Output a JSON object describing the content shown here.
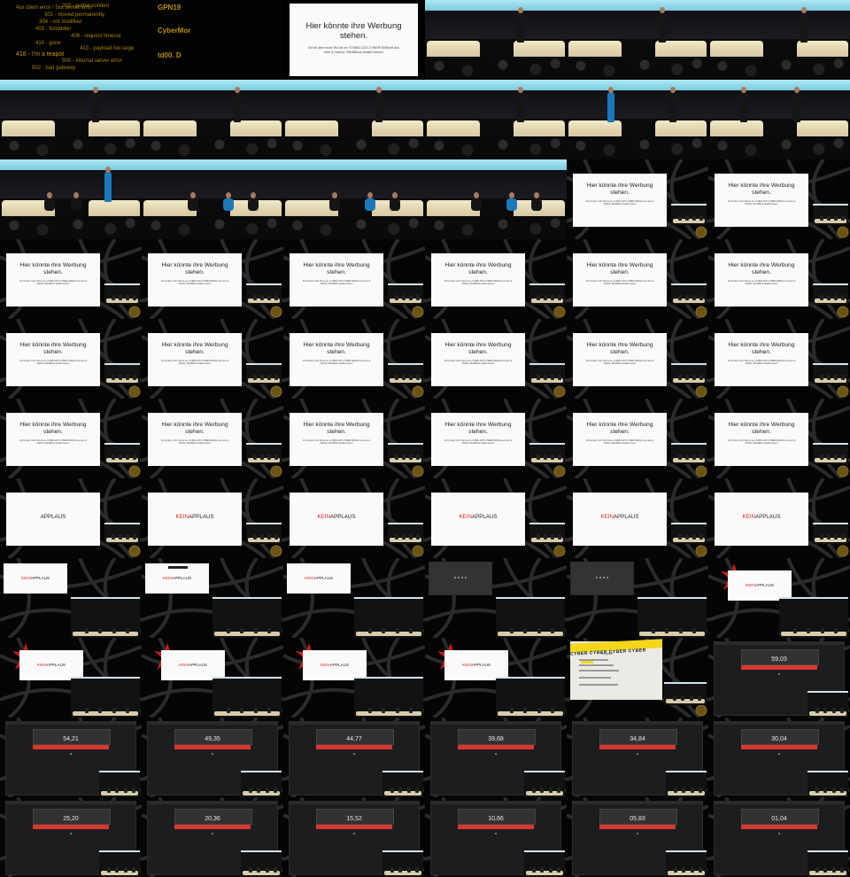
{
  "rows": [
    [
      {
        "kind": "term",
        "lines": [
          "4xx client error / 5xx server error",
          "202 - partial content",
          "301 - moved permanently",
          "304 - not modified",
          "403 - forbidden",
          "408 - request timeout",
          "410 - gone",
          "413 - payload too large",
          "418 - I'm a teapot",
          "500 - internal server error",
          "502 - bad gateway"
        ]
      },
      {
        "kind": "term2",
        "words": [
          "GPN19",
          "CyberMor",
          "td00. D"
        ]
      },
      {
        "kind": "ad-full"
      },
      {
        "kind": "stage",
        "variant": "single"
      },
      {
        "kind": "stage",
        "variant": "single"
      },
      {
        "kind": "stage",
        "variant": "single"
      }
    ],
    [
      {
        "kind": "stage",
        "variant": "single"
      },
      {
        "kind": "stage",
        "variant": "single"
      },
      {
        "kind": "stage",
        "variant": "single"
      },
      {
        "kind": "stage",
        "variant": "single"
      },
      {
        "kind": "stage",
        "variant": "blue-walk"
      },
      {
        "kind": "stage",
        "variant": "pair"
      }
    ],
    [
      {
        "kind": "stage",
        "variant": "seated-blue"
      },
      {
        "kind": "stage",
        "variant": "seated"
      },
      {
        "kind": "stage",
        "variant": "seated"
      },
      {
        "kind": "stage",
        "variant": "seated"
      },
      {
        "kind": "web-ad"
      },
      {
        "kind": "web-ad"
      }
    ],
    [
      {
        "kind": "web-ad"
      },
      {
        "kind": "web-ad"
      },
      {
        "kind": "web-ad"
      },
      {
        "kind": "web-ad"
      },
      {
        "kind": "web-ad"
      },
      {
        "kind": "web-ad"
      }
    ],
    [
      {
        "kind": "web-ad"
      },
      {
        "kind": "web-ad"
      },
      {
        "kind": "web-ad"
      },
      {
        "kind": "web-ad"
      },
      {
        "kind": "web-ad"
      },
      {
        "kind": "web-ad"
      }
    ],
    [
      {
        "kind": "web-ad"
      },
      {
        "kind": "web-ad"
      },
      {
        "kind": "web-ad"
      },
      {
        "kind": "web-ad"
      },
      {
        "kind": "web-ad"
      },
      {
        "kind": "web-ad"
      }
    ],
    [
      {
        "kind": "applaus",
        "kein": false
      },
      {
        "kind": "applaus",
        "kein": true
      },
      {
        "kind": "applaus",
        "kein": true
      },
      {
        "kind": "applaus",
        "kein": true
      },
      {
        "kind": "applaus",
        "kein": true
      },
      {
        "kind": "applaus",
        "kein": true
      }
    ],
    [
      {
        "kind": "applaus-small",
        "kein": true,
        "bar": false
      },
      {
        "kind": "applaus-small",
        "kein": true,
        "bar": true
      },
      {
        "kind": "applaus-small",
        "kein": true,
        "bar": false
      },
      {
        "kind": "dark-window"
      },
      {
        "kind": "dark-window"
      },
      {
        "kind": "applaus-red",
        "kein": true
      }
    ],
    [
      {
        "kind": "applaus-red",
        "kein": true
      },
      {
        "kind": "applaus-red",
        "kein": true
      },
      {
        "kind": "applaus-red",
        "kein": true
      },
      {
        "kind": "applaus-red",
        "kein": true
      },
      {
        "kind": "cyber"
      },
      {
        "kind": "timer",
        "time": "59,03"
      }
    ],
    [
      {
        "kind": "timer",
        "time": "54,21"
      },
      {
        "kind": "timer",
        "time": "49,35"
      },
      {
        "kind": "timer",
        "time": "44,77"
      },
      {
        "kind": "timer",
        "time": "39,68"
      },
      {
        "kind": "timer",
        "time": "34,84"
      },
      {
        "kind": "timer",
        "time": "30,04"
      }
    ],
    [
      {
        "kind": "timer",
        "time": "25,20"
      },
      {
        "kind": "timer",
        "time": "20,36"
      },
      {
        "kind": "timer",
        "time": "15,52"
      },
      {
        "kind": "timer",
        "time": "10,66"
      },
      {
        "kind": "timer",
        "time": "05,83"
      },
      {
        "kind": "timer",
        "time": "01,04"
      }
    ]
  ],
  "ad": {
    "headline": "Hier könnte ihre Werbung stehen.",
    "subline": "Ctrl ist aber nicht: Ruf an an +0 0800-1337-CYBER 0006(mit aus dem & Haribo): WerbBlock deaktiv besen!"
  },
  "applaus": {
    "kein": "KEIN",
    "word": "APPLAUS"
  },
  "cyber": {
    "tape": "CYBER CYBER CYBER CYBER",
    "title": "TeCyber!"
  },
  "colors": {
    "accent_red": "#e0241f",
    "timer_red": "#d7382e",
    "terminal": "#b6900f",
    "stage_screen": "#aee9f5"
  }
}
